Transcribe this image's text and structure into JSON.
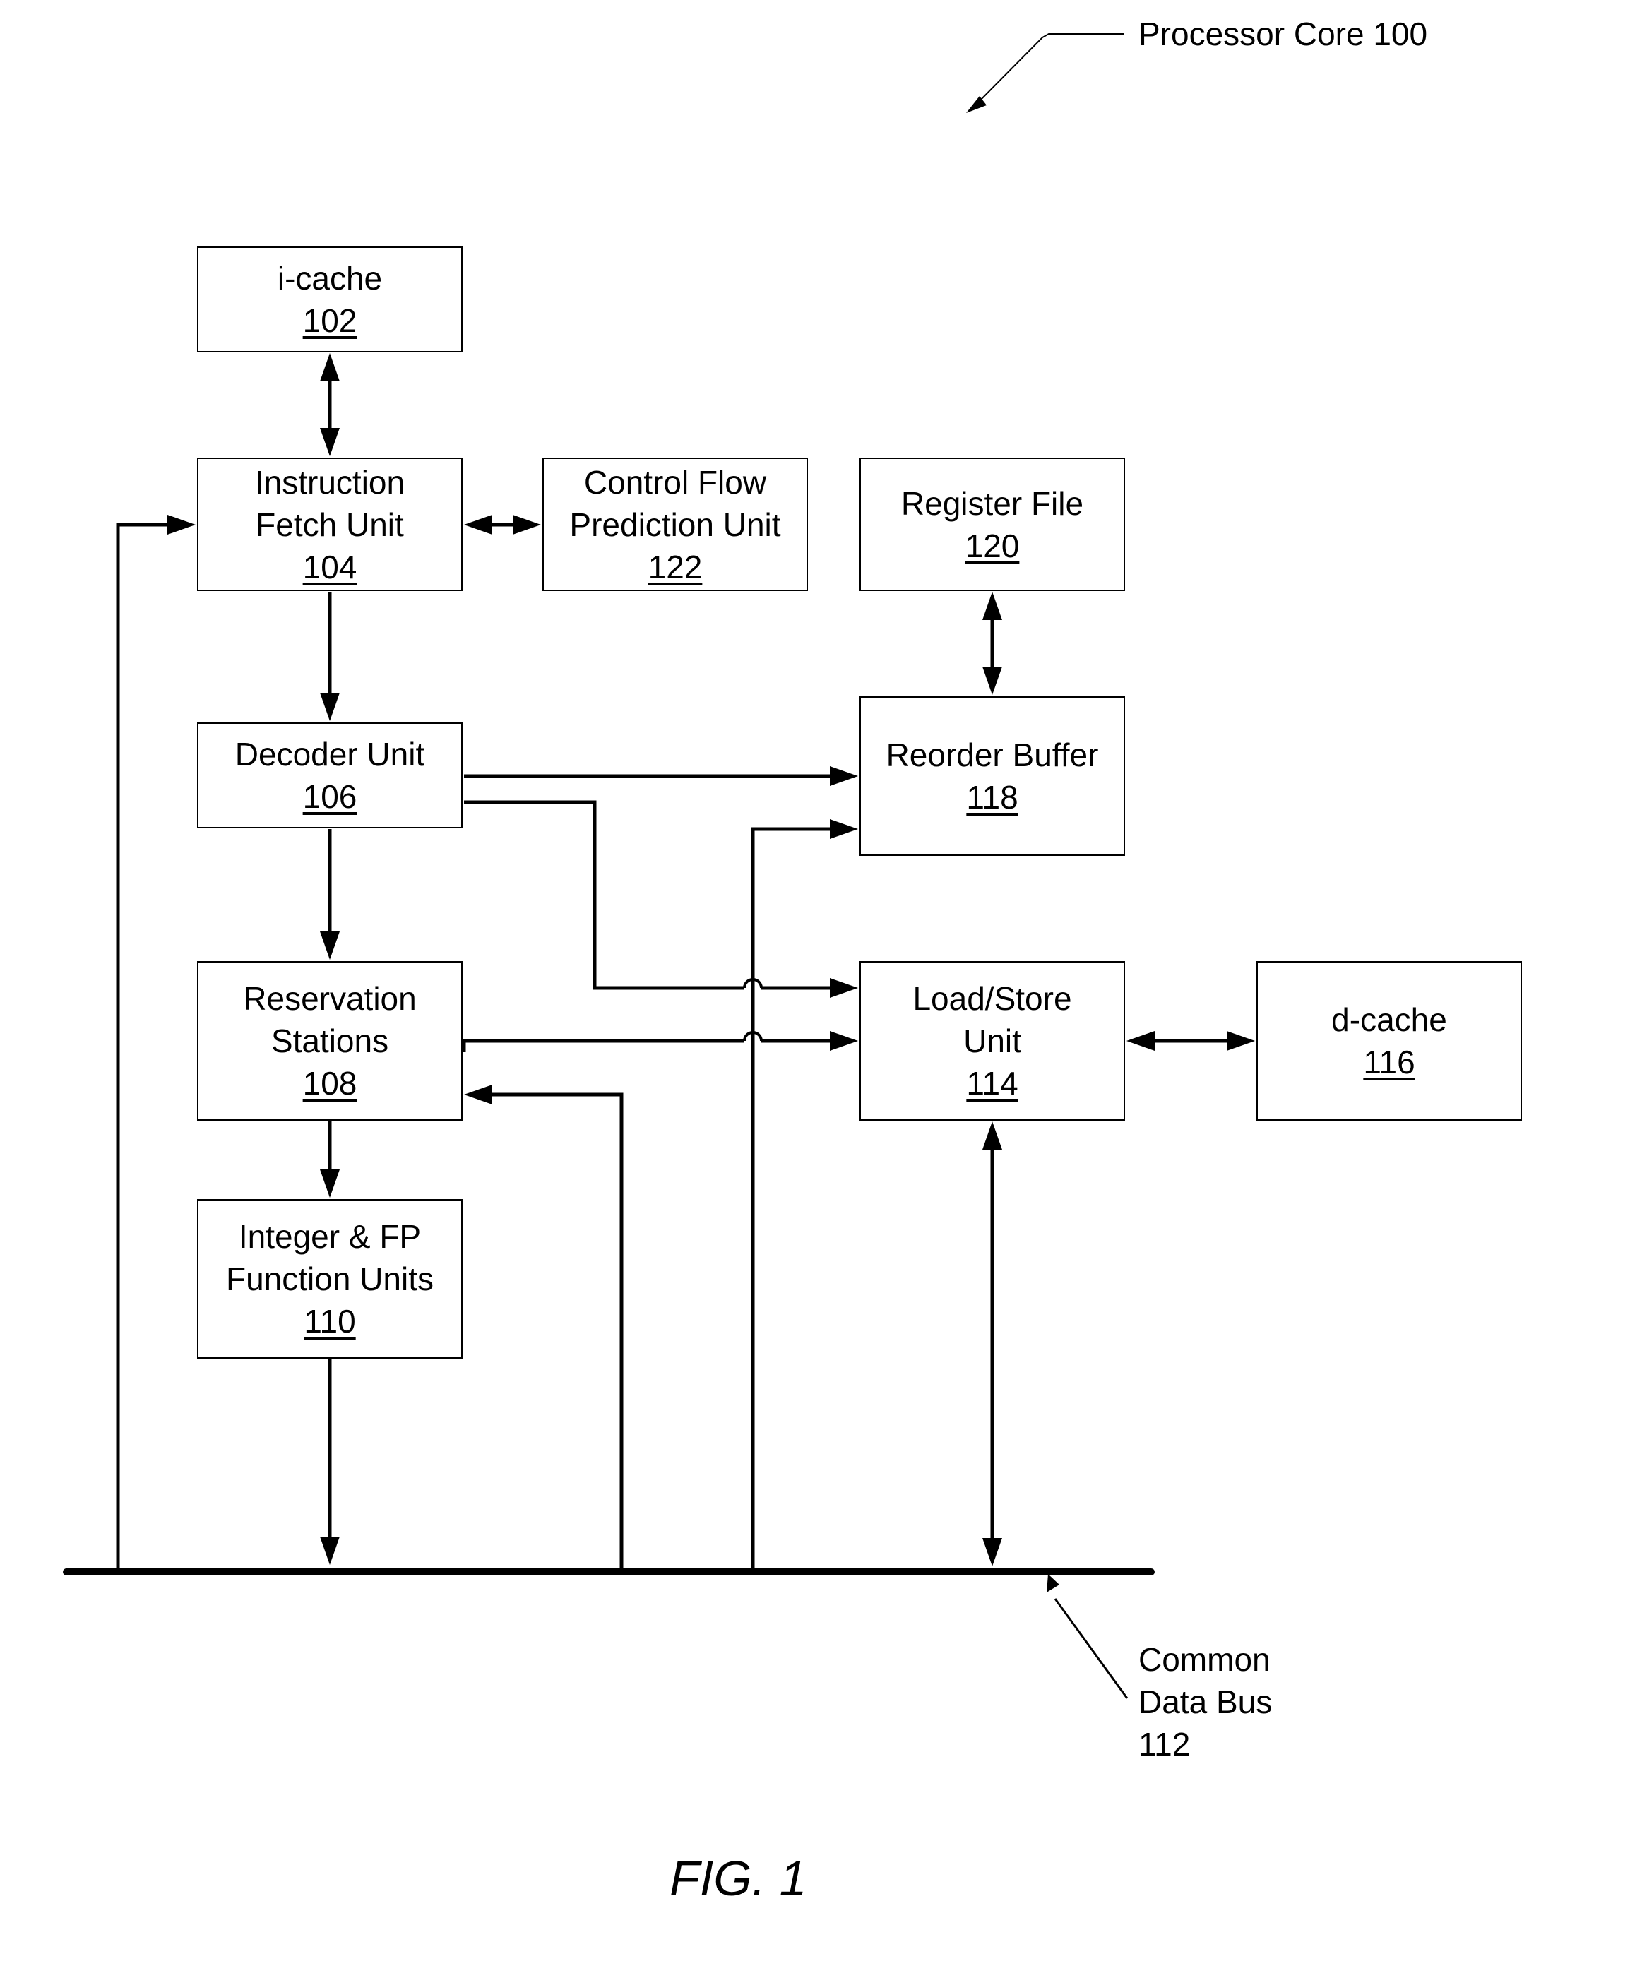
{
  "title": "Processor Core 100",
  "figure_caption": "FIG. 1",
  "bus": {
    "line1": "Common",
    "line2": "Data Bus",
    "line3": "112"
  },
  "blocks": {
    "icache": {
      "lines": [
        "i-cache"
      ],
      "ref": "102"
    },
    "ifu": {
      "lines": [
        "Instruction",
        "Fetch Unit"
      ],
      "ref": "104"
    },
    "cfpu": {
      "lines": [
        "Control Flow",
        "Prediction Unit"
      ],
      "ref": "122"
    },
    "regfile": {
      "lines": [
        "Register File"
      ],
      "ref": "120"
    },
    "decoder": {
      "lines": [
        "Decoder Unit"
      ],
      "ref": "106"
    },
    "rob": {
      "lines": [
        "Reorder Buffer"
      ],
      "ref": "118"
    },
    "rs": {
      "lines": [
        "Reservation",
        "Stations"
      ],
      "ref": "108"
    },
    "lsu": {
      "lines": [
        "Load/Store",
        "Unit"
      ],
      "ref": "114"
    },
    "dcache": {
      "lines": [
        "d-cache"
      ],
      "ref": "116"
    },
    "intfp": {
      "lines": [
        "Integer & FP",
        "Function Units"
      ],
      "ref": "110"
    }
  },
  "connections": [
    {
      "from": "i-cache",
      "to": "Instruction Fetch Unit",
      "direction": "bidirectional"
    },
    {
      "from": "Instruction Fetch Unit",
      "to": "Control Flow Prediction Unit",
      "direction": "bidirectional"
    },
    {
      "from": "Instruction Fetch Unit",
      "to": "Decoder Unit",
      "direction": "forward"
    },
    {
      "from": "Register File",
      "to": "Reorder Buffer",
      "direction": "bidirectional"
    },
    {
      "from": "Decoder Unit",
      "to": "Reorder Buffer",
      "direction": "forward"
    },
    {
      "from": "Decoder Unit",
      "to": "Load/Store Unit",
      "direction": "forward"
    },
    {
      "from": "Decoder Unit",
      "to": "Reservation Stations",
      "direction": "forward"
    },
    {
      "from": "Reservation Stations",
      "to": "Load/Store Unit",
      "direction": "forward"
    },
    {
      "from": "Reservation Stations",
      "to": "Integer & FP Function Units",
      "direction": "forward"
    },
    {
      "from": "Load/Store Unit",
      "to": "d-cache",
      "direction": "bidirectional"
    },
    {
      "from": "Load/Store Unit",
      "to": "Common Data Bus",
      "direction": "bidirectional"
    },
    {
      "from": "Integer & FP Function Units",
      "to": "Common Data Bus",
      "direction": "forward"
    },
    {
      "from": "Common Data Bus",
      "to": "Instruction Fetch Unit",
      "direction": "forward"
    },
    {
      "from": "Common Data Bus",
      "to": "Reservation Stations",
      "direction": "forward"
    },
    {
      "from": "Common Data Bus",
      "to": "Reorder Buffer",
      "direction": "forward"
    }
  ]
}
